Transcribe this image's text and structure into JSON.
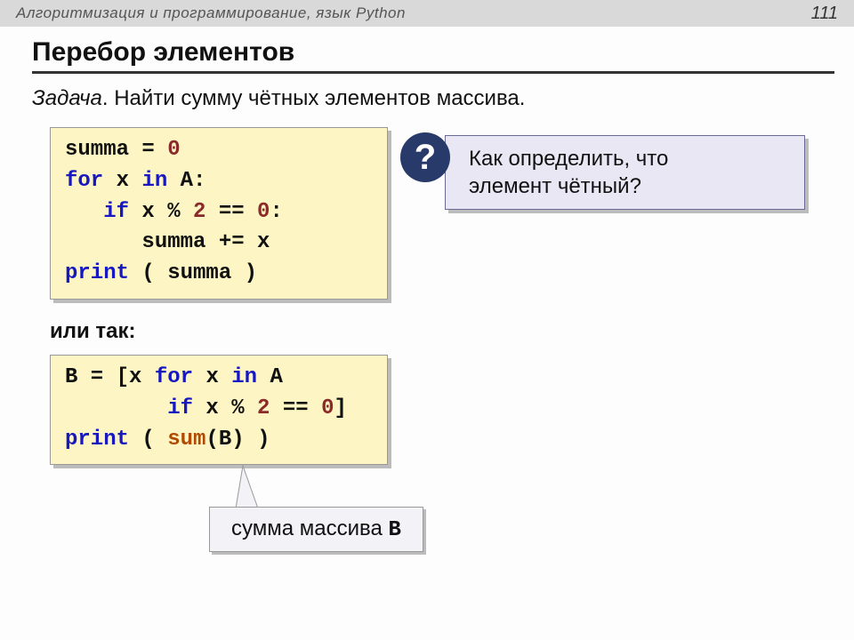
{
  "header": {
    "title": "Алгоритмизация и программирование, язык Python",
    "page": "111"
  },
  "heading": "Перебор элементов",
  "task": {
    "label": "Задача",
    "text": ". Найти сумму чётных элементов массива."
  },
  "question": {
    "mark": "?",
    "text_l1": "Как определить, что",
    "text_l2": "элемент чётный?"
  },
  "code1": {
    "l1a": "summa = ",
    "l1b": "0",
    "l2a": "for",
    "l2b": " x ",
    "l2c": "in",
    "l2d": " A:",
    "l3a": "   if",
    "l3b": " x % ",
    "l3c": "2",
    "l3d": " == ",
    "l3e": "0",
    "l3f": ":",
    "l4": "      summa += x",
    "l5a": "print",
    "l5b": " ( summa )"
  },
  "or_label": "или так:",
  "code2": {
    "l1a": "B = [x ",
    "l1b": "for",
    "l1c": " x ",
    "l1d": "in",
    "l1e": " A",
    "l2a": "        if",
    "l2b": " x % ",
    "l2c": "2",
    "l2d": " == ",
    "l2e": "0",
    "l2f": "]",
    "l3a": "print",
    "l3b": " ( ",
    "l3c": "sum",
    "l3d": "(B) )"
  },
  "sum_callout": {
    "text": "сумма массива ",
    "var": "B"
  }
}
